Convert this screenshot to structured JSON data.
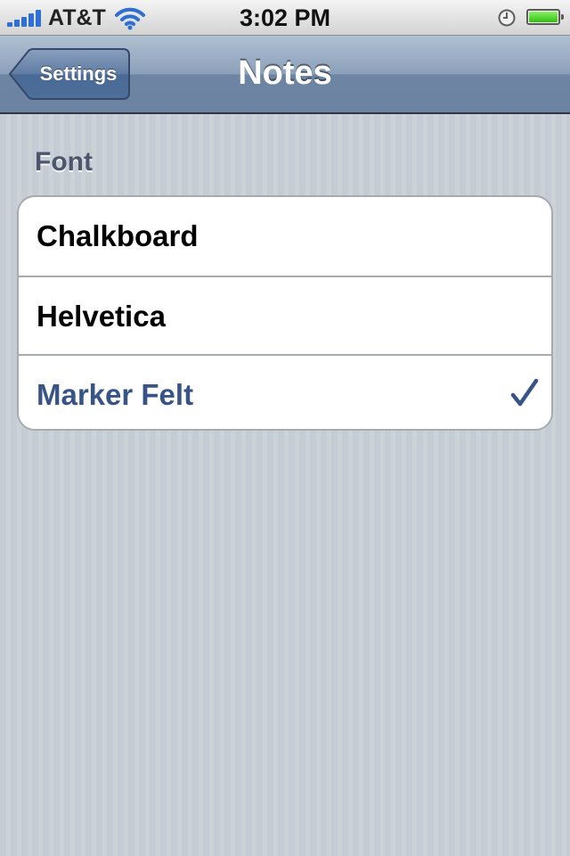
{
  "status_bar": {
    "carrier": "AT&T",
    "time": "3:02 PM",
    "battery_level": 1.0,
    "signal_bars": 5,
    "colors": {
      "signal": "#2f6fd2",
      "battery": "#2ec10e"
    }
  },
  "nav_bar": {
    "back_label": "Settings",
    "title": "Notes"
  },
  "section": {
    "header": "Font",
    "options": [
      {
        "label": "Chalkboard",
        "selected": false
      },
      {
        "label": "Helvetica",
        "selected": false
      },
      {
        "label": "Marker Felt",
        "selected": true
      }
    ]
  },
  "icons": {
    "signal": "signal-strength-icon",
    "wifi": "wifi-icon",
    "alarm": "alarm-clock-icon",
    "battery": "battery-icon",
    "back": "back-arrow-icon",
    "check": "checkmark-icon"
  },
  "colors": {
    "selected_text": "#385487",
    "nav_bar": "#6d84a3",
    "background": "#c5ccd4"
  }
}
